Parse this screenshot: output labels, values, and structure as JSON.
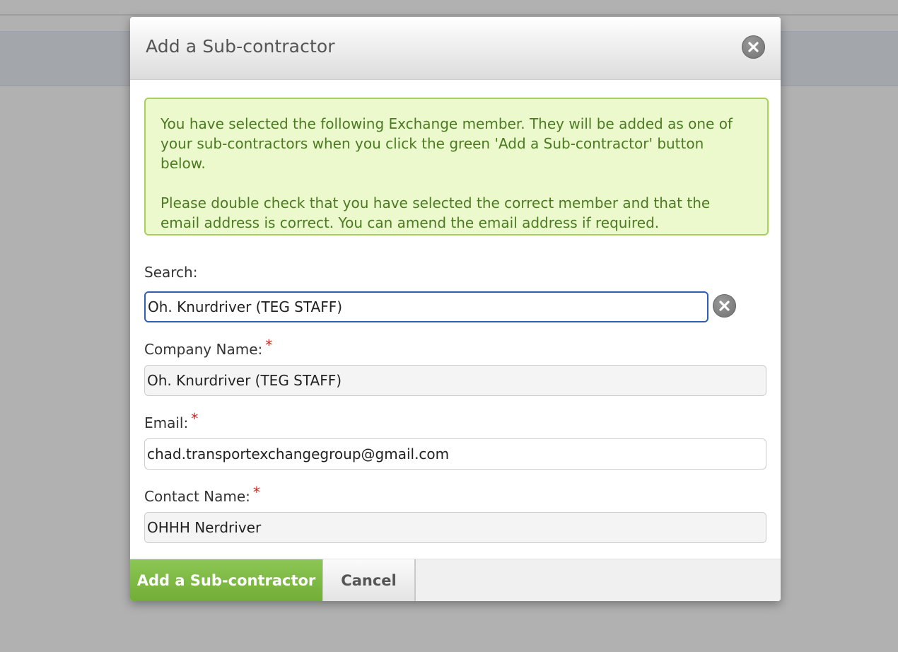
{
  "modal": {
    "title": "Add a Sub-contractor",
    "close_icon": "close-icon"
  },
  "notice": {
    "paragraph1": "You have selected the following Exchange member. They will be added as one of your sub-contractors when you click the green 'Add a Sub-contractor' button below.",
    "paragraph2": "Please double check that you have selected the correct member and that the email address is correct. You can amend the email address if required."
  },
  "form": {
    "search": {
      "label": "Search:",
      "value": "Oh. Knurdriver (TEG STAFF)",
      "clear_icon": "clear-icon"
    },
    "company_name": {
      "label": "Company Name:",
      "required_marker": "*",
      "value": "Oh. Knurdriver (TEG STAFF)"
    },
    "email": {
      "label": "Email:",
      "required_marker": "*",
      "value": "chad.transportexchangegroup@gmail.com"
    },
    "contact_name": {
      "label": "Contact Name:",
      "required_marker": "*",
      "value": "OHHH Nerdriver"
    }
  },
  "footer": {
    "submit_label": "Add a Sub-contractor",
    "cancel_label": "Cancel"
  },
  "colors": {
    "accent_green": "#7cb843",
    "notice_bg": "#ebf9cd",
    "notice_text": "#4b7a21",
    "focus_blue": "#2f5fb3",
    "required_red": "#d0211c"
  }
}
